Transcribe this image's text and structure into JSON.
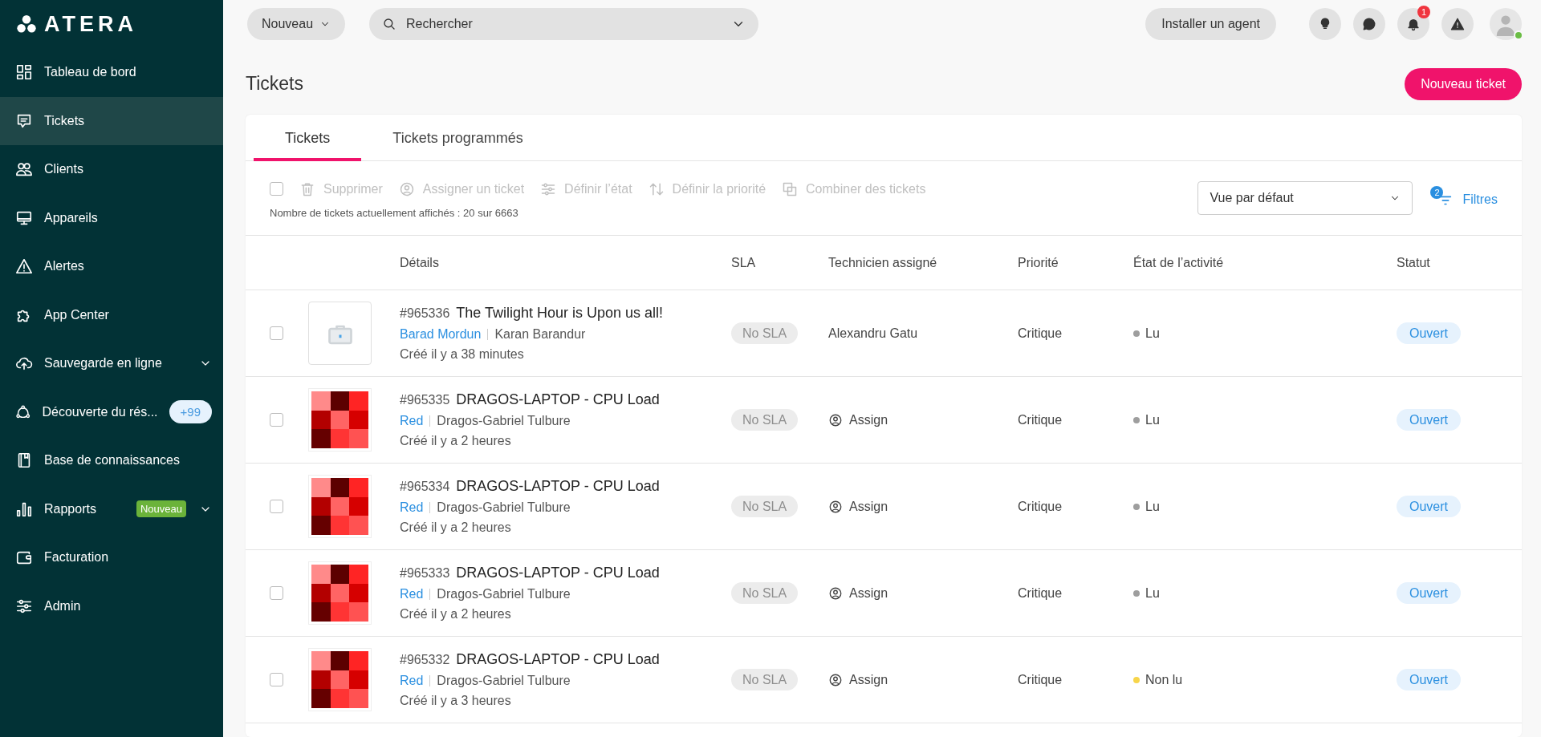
{
  "sidebar": {
    "logo": "ATERA",
    "items": [
      {
        "label": "Tableau de bord",
        "selected": false
      },
      {
        "label": "Tickets",
        "selected": true
      },
      {
        "label": "Clients",
        "selected": false
      },
      {
        "label": "Appareils",
        "selected": false
      },
      {
        "label": "Alertes",
        "selected": false
      },
      {
        "label": "App Center",
        "selected": false
      },
      {
        "label": "Sauvegarde en ligne",
        "selected": false,
        "expandable": true
      },
      {
        "label": "Découverte du rés...",
        "selected": false,
        "badge": {
          "kind": "count",
          "text": "+99"
        }
      },
      {
        "label": "Base de connaissances",
        "selected": false
      },
      {
        "label": "Rapports",
        "selected": false,
        "expandable": true,
        "badge": {
          "kind": "new",
          "text": "Nouveau"
        }
      },
      {
        "label": "Facturation",
        "selected": false
      },
      {
        "label": "Admin",
        "selected": false
      }
    ]
  },
  "topbar": {
    "new_button": "Nouveau",
    "search": {
      "placeholder": "Rechercher"
    },
    "install_button": "Installer un agent",
    "notifications_count": "1",
    "user_online": true
  },
  "page": {
    "title": "Tickets",
    "new_ticket_button": "Nouveau ticket"
  },
  "tabs": [
    {
      "label": "Tickets",
      "selected": true
    },
    {
      "label": "Tickets programmés",
      "selected": false
    }
  ],
  "toolbar": {
    "select_all": false,
    "actions": [
      "Supprimer",
      "Assigner un ticket",
      "Définir l’état",
      "Définir la priorité",
      "Combiner des tickets"
    ],
    "count_text": "Nombre de tickets actuellement affichés : 20 sur 6663",
    "view_select": "Vue par défaut",
    "filters": {
      "label": "Filtres",
      "count": "2"
    }
  },
  "table": {
    "columns": [
      "Détails",
      "SLA",
      "Technicien assigné",
      "Priorité",
      "État de l’activité",
      "Statut"
    ],
    "rows": [
      {
        "checked": false,
        "thumbnail": {
          "kind": "briefcase"
        },
        "number": "#965336",
        "title": "The Twilight Hour is Upon us all!",
        "customer": "Barad Mordun",
        "contact": "Karan Barandur",
        "created": "Créé il y a 38 minutes",
        "sla": "No SLA",
        "technician": {
          "assigned": true,
          "text": "Alexandru Gatu"
        },
        "priority": "Critique",
        "activity": {
          "text": "Lu",
          "color": "#9e9e9e"
        },
        "status": "Ouvert"
      },
      {
        "checked": false,
        "thumbnail": {
          "kind": "identicon"
        },
        "number": "#965335",
        "title": "DRAGOS-LAPTOP - CPU Load",
        "customer": "Red",
        "contact": "Dragos-Gabriel Tulbure",
        "created": "Créé il y a 2 heures",
        "sla": "No SLA",
        "technician": {
          "assigned": false,
          "text": "Assign"
        },
        "priority": "Critique",
        "activity": {
          "text": "Lu",
          "color": "#9e9e9e"
        },
        "status": "Ouvert"
      },
      {
        "checked": false,
        "thumbnail": {
          "kind": "identicon"
        },
        "number": "#965334",
        "title": "DRAGOS-LAPTOP - CPU Load",
        "customer": "Red",
        "contact": "Dragos-Gabriel Tulbure",
        "created": "Créé il y a 2 heures",
        "sla": "No SLA",
        "technician": {
          "assigned": false,
          "text": "Assign"
        },
        "priority": "Critique",
        "activity": {
          "text": "Lu",
          "color": "#9e9e9e"
        },
        "status": "Ouvert"
      },
      {
        "checked": false,
        "thumbnail": {
          "kind": "identicon"
        },
        "number": "#965333",
        "title": "DRAGOS-LAPTOP - CPU Load",
        "customer": "Red",
        "contact": "Dragos-Gabriel Tulbure",
        "created": "Créé il y a 2 heures",
        "sla": "No SLA",
        "technician": {
          "assigned": false,
          "text": "Assign"
        },
        "priority": "Critique",
        "activity": {
          "text": "Lu",
          "color": "#9e9e9e"
        },
        "status": "Ouvert"
      },
      {
        "checked": false,
        "thumbnail": {
          "kind": "identicon"
        },
        "number": "#965332",
        "title": "DRAGOS-LAPTOP - CPU Load",
        "customer": "Red",
        "contact": "Dragos-Gabriel Tulbure",
        "created": "Créé il y a 3 heures",
        "sla": "No SLA",
        "technician": {
          "assigned": false,
          "text": "Assign"
        },
        "priority": "Critique",
        "activity": {
          "text": "Non lu",
          "color": "#f7d54a"
        },
        "status": "Ouvert"
      }
    ]
  }
}
